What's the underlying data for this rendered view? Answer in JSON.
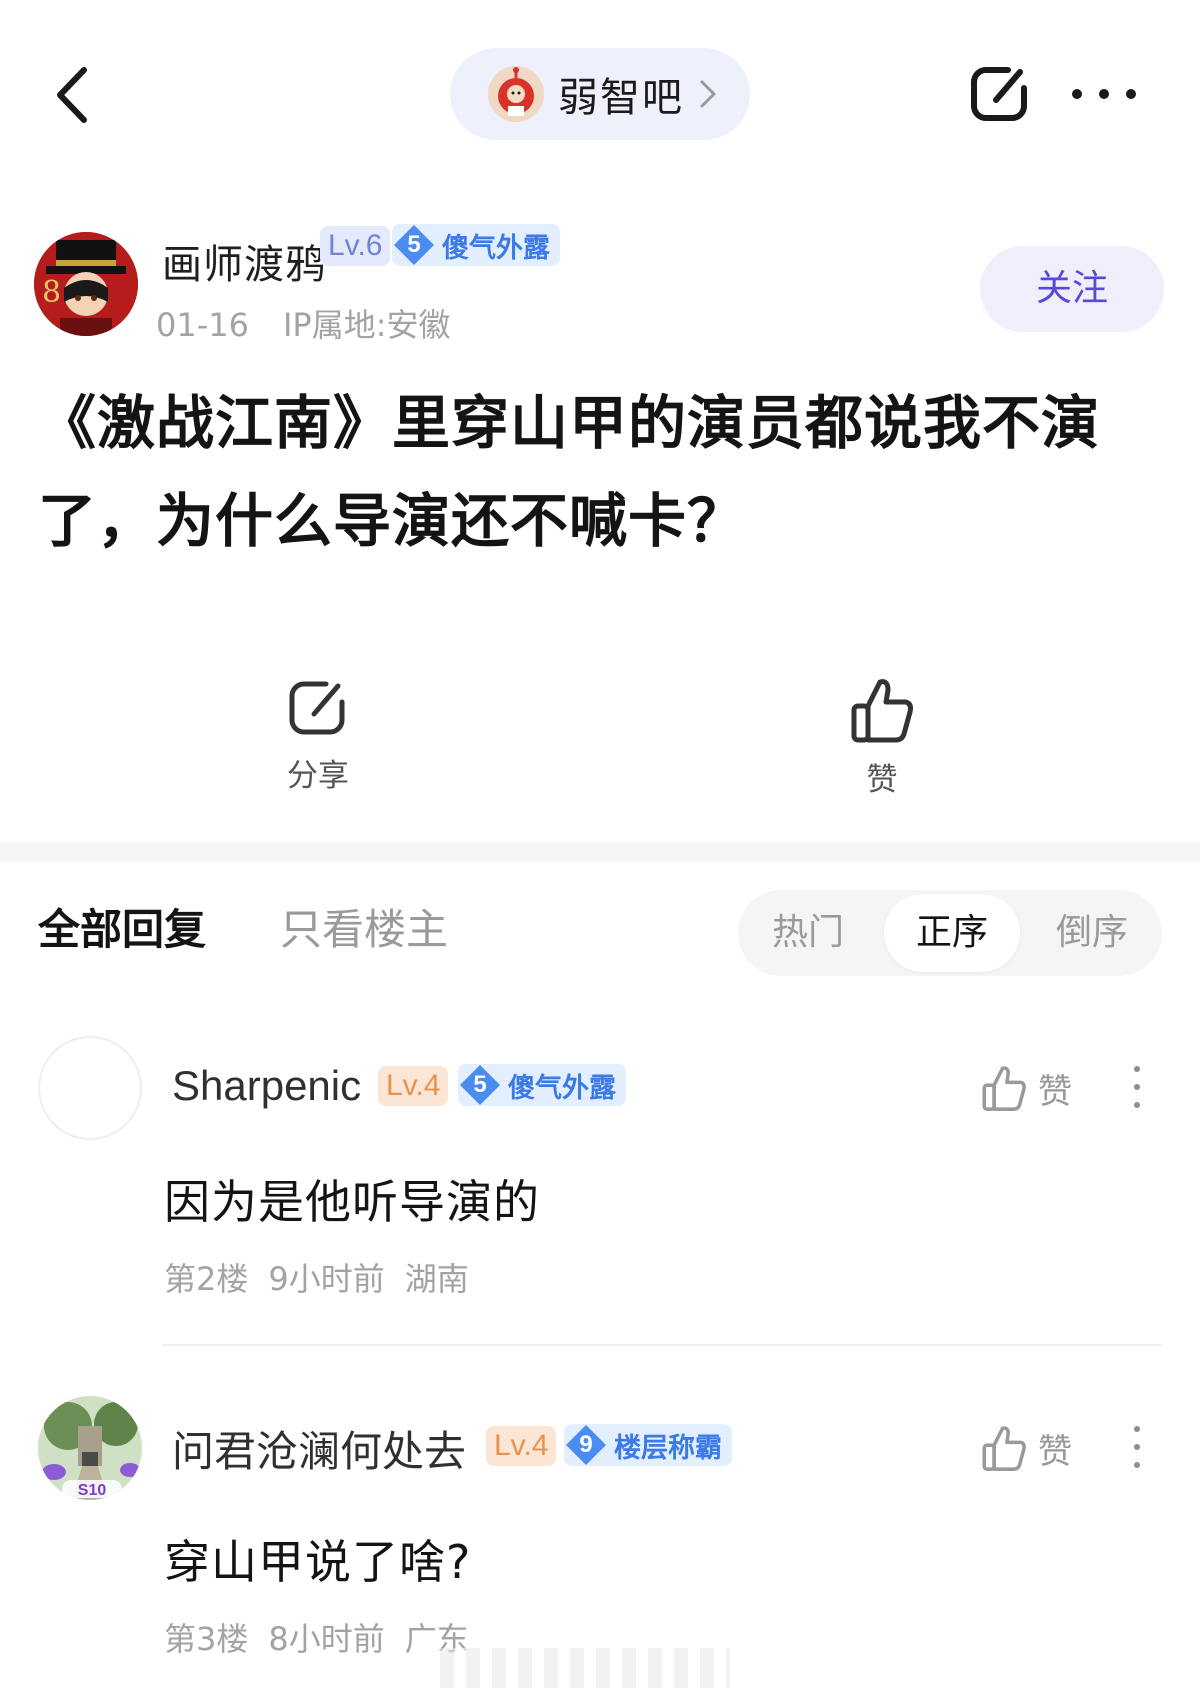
{
  "topbar": {
    "forum_name": "弱智吧"
  },
  "author": {
    "name": "画师渡鸦",
    "level": "Lv.6",
    "badge_number": "5",
    "badge_title": "傻气外露",
    "date": "01-16",
    "ip_location": "IP属地:安徽",
    "follow_label": "关注"
  },
  "post": {
    "title": "《激战江南》里穿山甲的演员都说我不演了，为什么导演还不喊卡？"
  },
  "actions": {
    "share_label": "分享",
    "like_label": "赞"
  },
  "reply_tabs": {
    "all": "全部回复",
    "op_only": "只看楼主",
    "sort_hot": "热门",
    "sort_asc": "正序",
    "sort_desc": "倒序"
  },
  "comments": [
    {
      "username": "Sharpenic",
      "level": "Lv.4",
      "badge_number": "5",
      "badge_title": "傻气外露",
      "like_label": "赞",
      "text": "因为是他听导演的",
      "floor": "第2楼",
      "time": "9小时前",
      "location": "湖南"
    },
    {
      "username": "问君沧澜何处去",
      "level": "Lv.4",
      "badge_number": "9",
      "badge_title": "楼层称霸",
      "like_label": "赞",
      "text": "穿山甲说了啥?",
      "floor": "第3楼",
      "time": "8小时前",
      "location": "广东",
      "avatar_tag": "S10"
    }
  ],
  "colors": {
    "accent_purple": "#5a48d9",
    "badge_blue": "#3c7be6",
    "level_blue": "#6c86d9",
    "level_orange": "#e7934c"
  },
  "icons": [
    "back-arrow-icon",
    "forum-avatar-icon",
    "chevron-right-icon",
    "share-icon",
    "more-icon",
    "thumbs-up-icon",
    "diamond-badge-icon"
  ]
}
